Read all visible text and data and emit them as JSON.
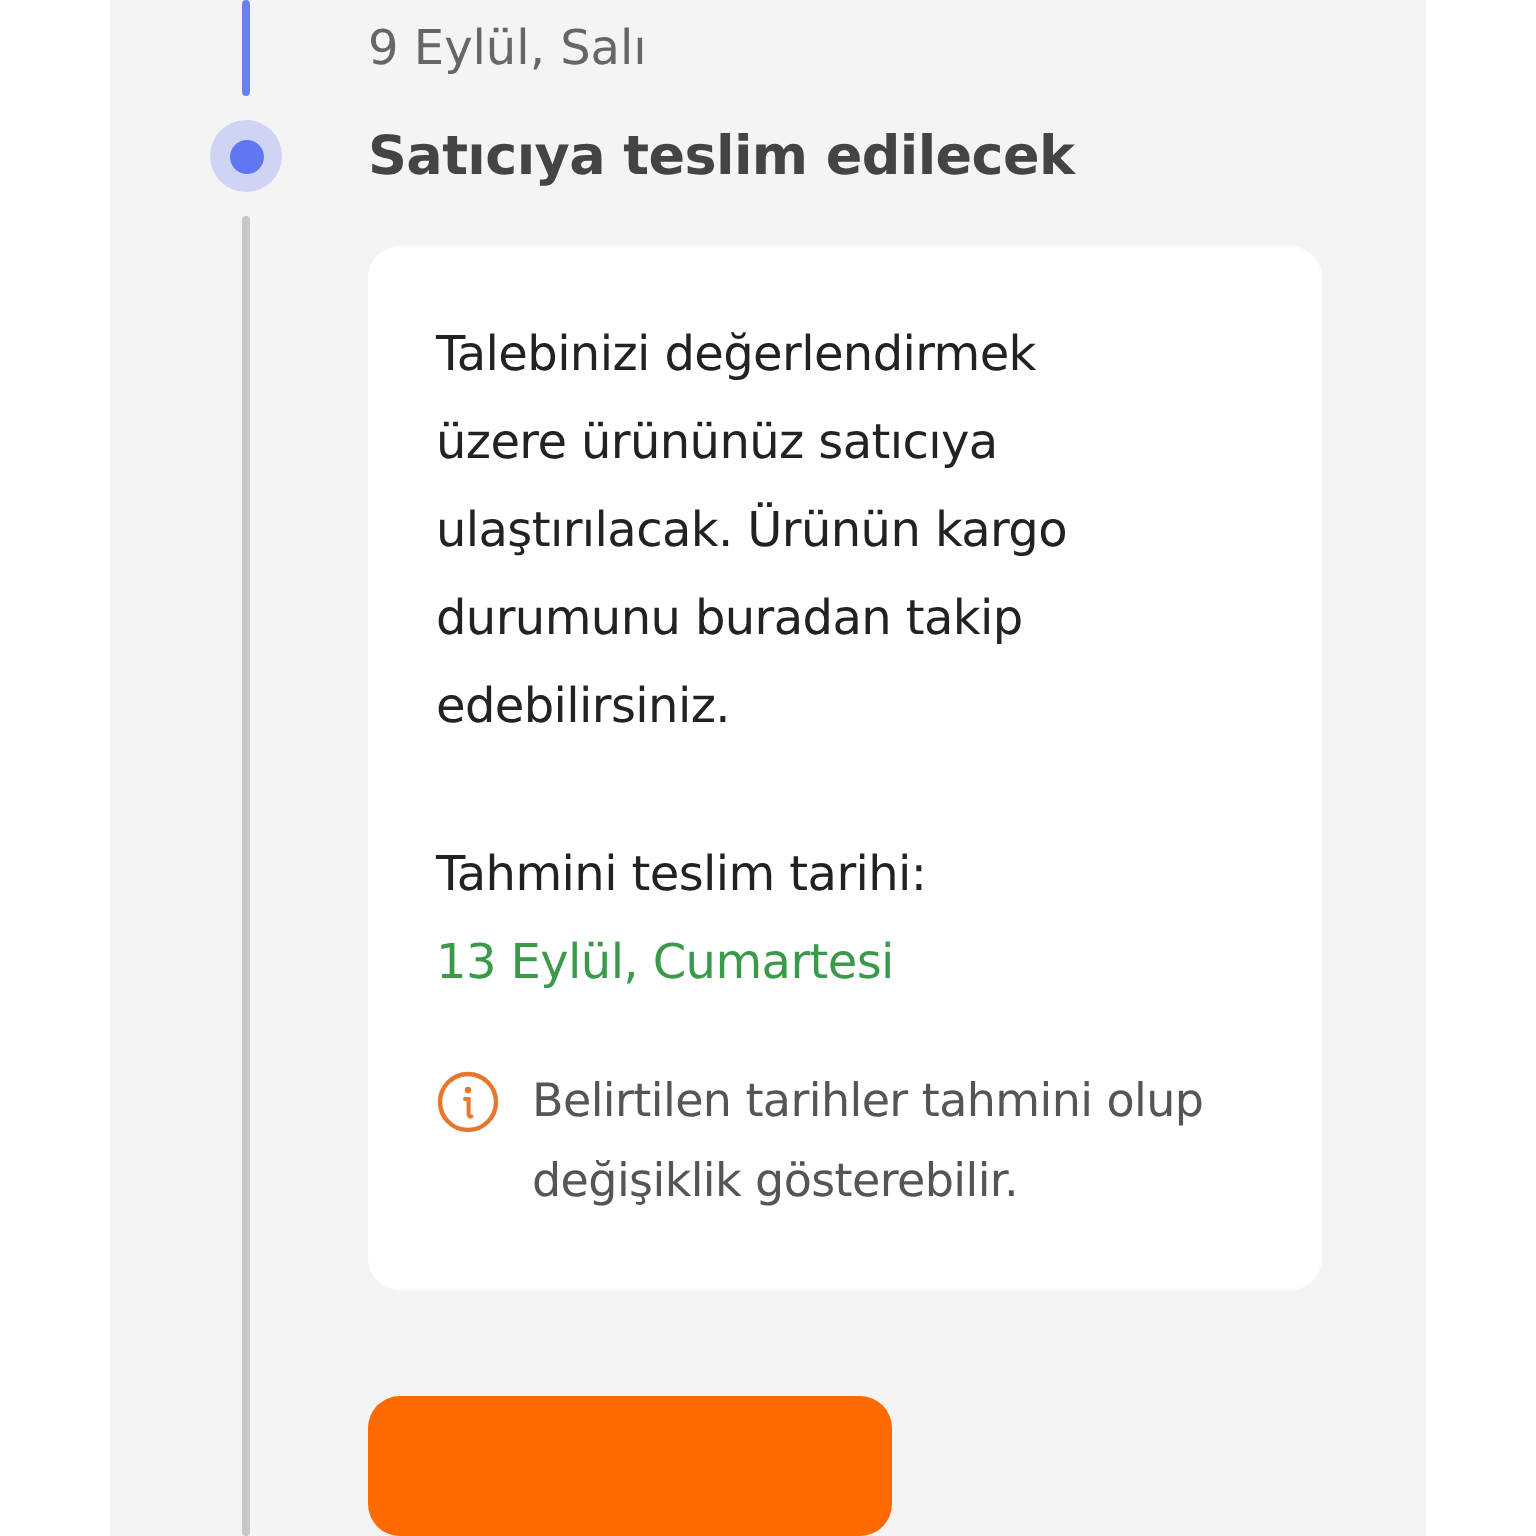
{
  "previous_step": {
    "date": "9 Eylül, Salı",
    "completed": true
  },
  "current_step": {
    "title": "Satıcıya teslim edilecek",
    "active": true
  },
  "card": {
    "description": "Talebinizi değerlendirmek üzere ürününüz satıcıya ulaştırılacak. Ürünün kargo durumunu buradan takip edebilirsiniz.",
    "estimate_label": "Tahmini teslim tarihi:",
    "estimate_date": "13 Eylül, Cumartesi",
    "note": "Belirtilen tarihler tahmini olup değişiklik gösterebilir."
  }
}
